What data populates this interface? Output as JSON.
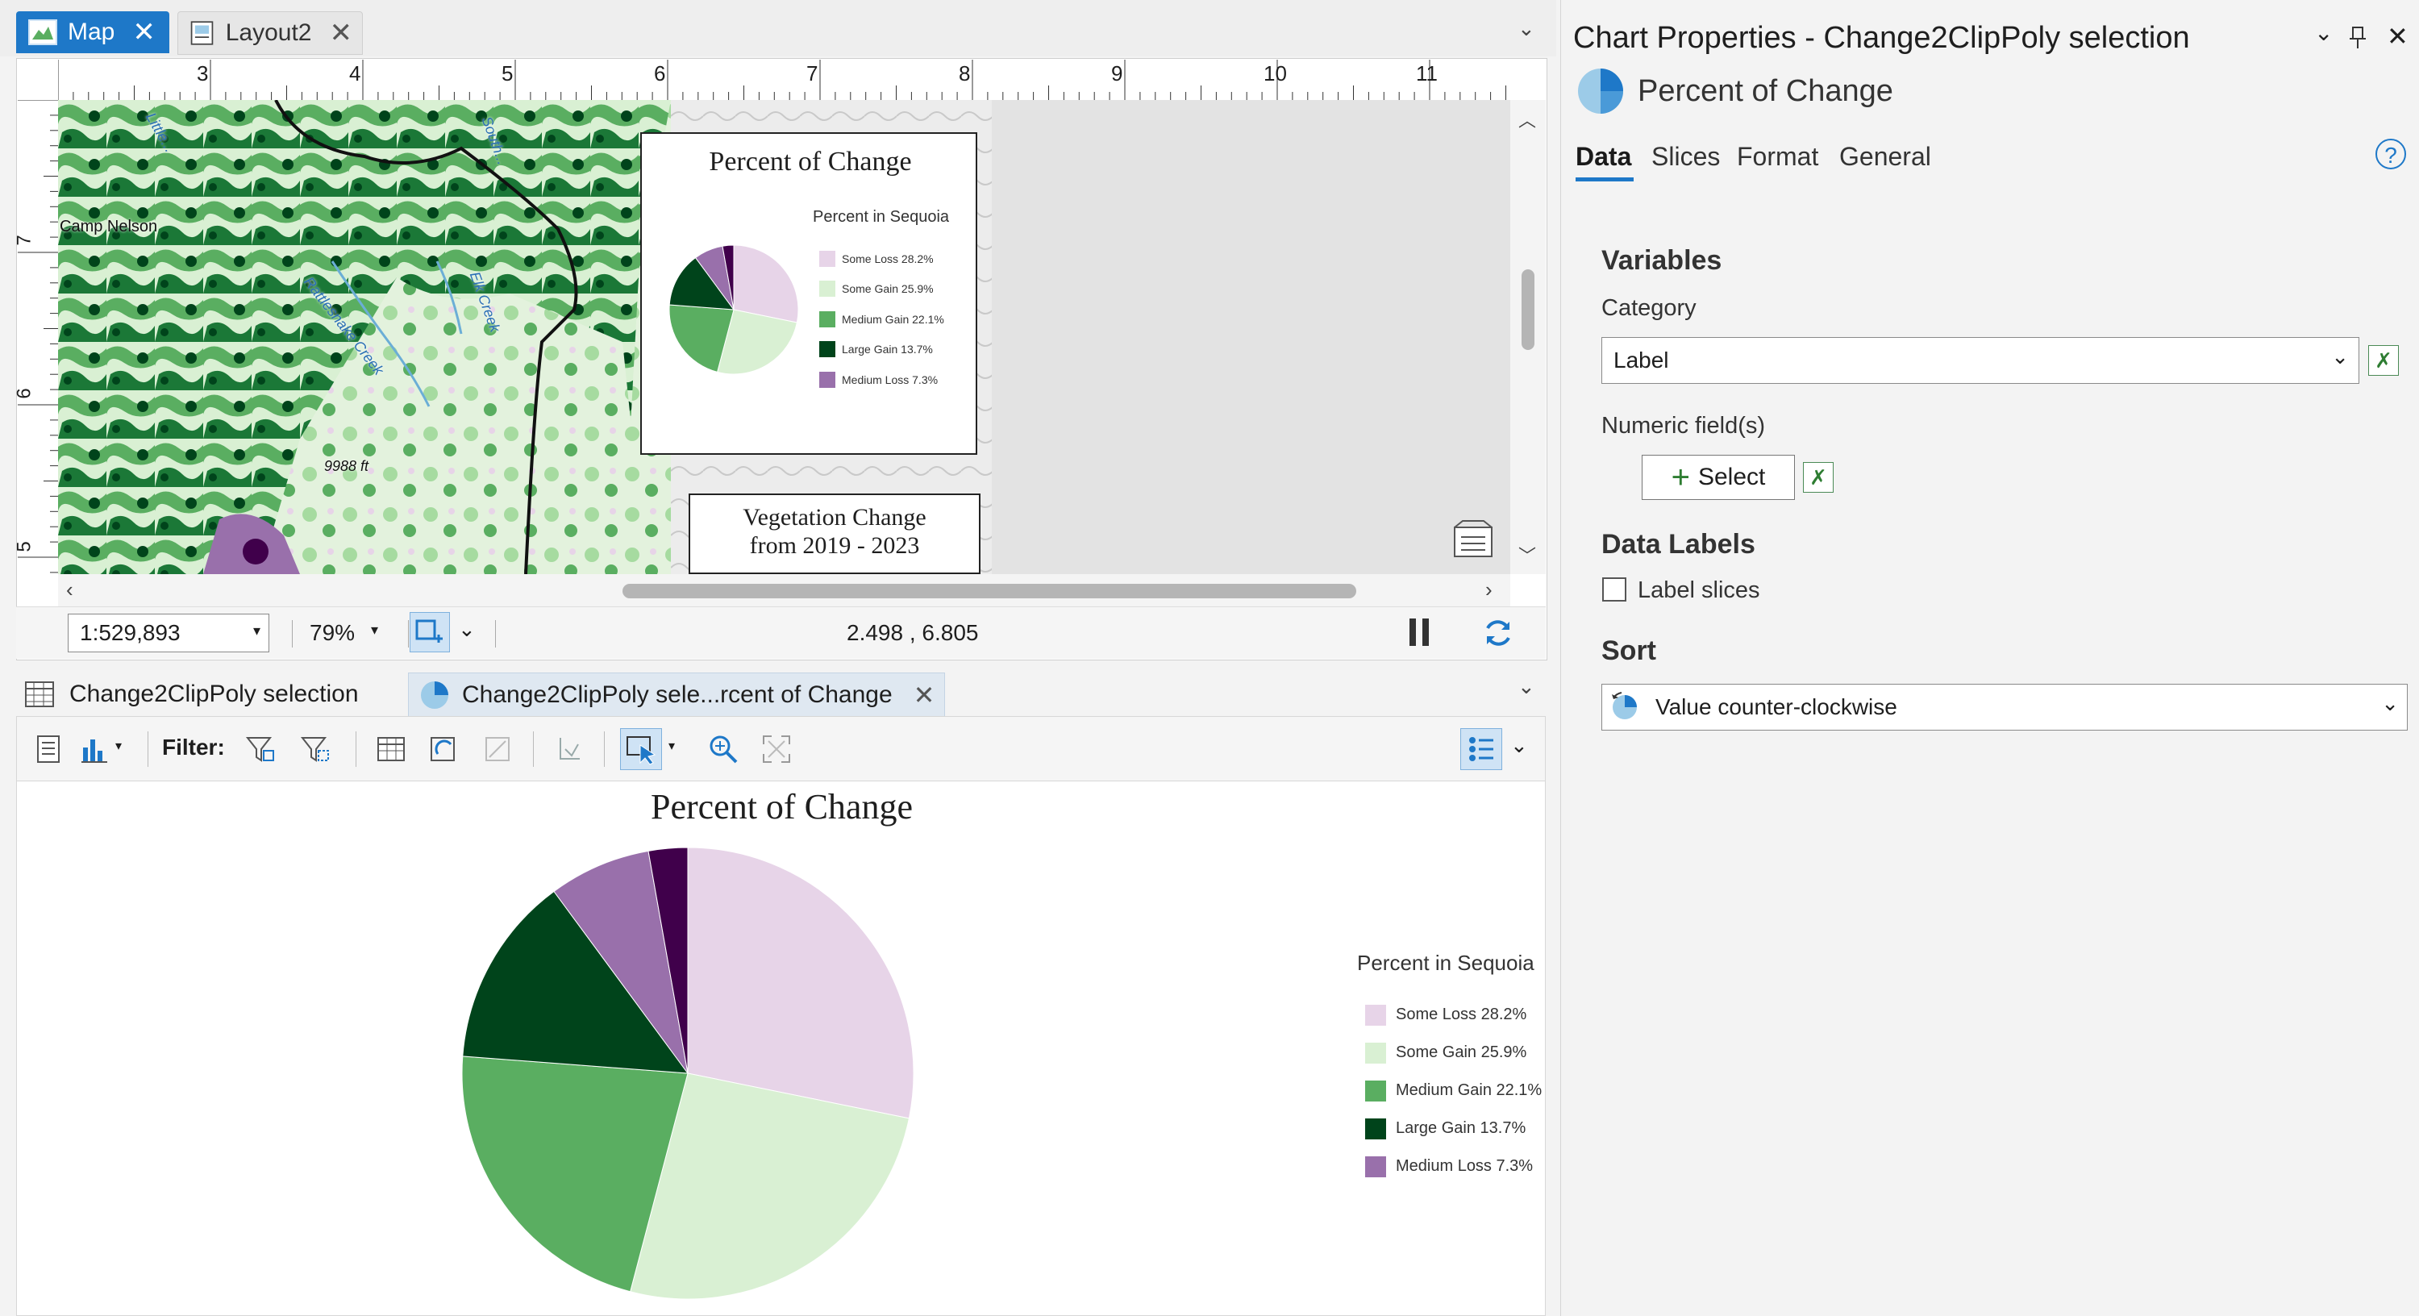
{
  "top_tabs": {
    "map": {
      "label": "Map"
    },
    "layout": {
      "label": "Layout2"
    }
  },
  "map": {
    "ruler_h": [
      "3",
      "4",
      "5",
      "6",
      "7",
      "8",
      "9",
      "10",
      "11"
    ],
    "ruler_v": [
      "7",
      "6",
      "5"
    ],
    "labels": {
      "camp_nelson": "Camp Nelson",
      "elevation": "9988 ft",
      "rattlesnake": "Rattlesnake Creek",
      "elk": "Elk Creek",
      "little": "Little...",
      "south": "South..."
    },
    "inset": {
      "title": "Percent of Change",
      "legend_title": "Percent in Sequoia"
    },
    "title_box": {
      "line1": "Vegetation Change",
      "line2": "from 2019 - 2023"
    },
    "scale": "1:529,893",
    "zoom": "79%",
    "coords": "2.498 , 6.805"
  },
  "bottom_tabs": {
    "table": {
      "label": "Change2ClipPoly selection"
    },
    "chart": {
      "label": "Change2ClipPoly sele...rcent of Change"
    }
  },
  "toolbar": {
    "filter_label": "Filter:"
  },
  "chart_data": {
    "type": "pie",
    "title": "Percent of Change",
    "legend_title": "Percent in Sequoia",
    "legend_position": "right",
    "slices": [
      {
        "label": "Some Loss 28.2%",
        "value": 28.2,
        "color": "#e7d4e8"
      },
      {
        "label": "Some Gain 25.9%",
        "value": 25.9,
        "color": "#d9f0d3"
      },
      {
        "label": "Medium Gain 22.1%",
        "value": 22.1,
        "color": "#5aae61"
      },
      {
        "label": "Large Gain 13.7%",
        "value": 13.7,
        "color": "#00441b"
      },
      {
        "label": "Medium Loss 7.3%",
        "value": 7.3,
        "color": "#9970ab"
      },
      {
        "label": "",
        "value": 2.8,
        "color": "#40004b"
      }
    ]
  },
  "properties": {
    "title": "Chart Properties - Change2ClipPoly selection",
    "chart_name": "Percent of Change",
    "tabs": [
      "Data",
      "Slices",
      "Format",
      "General"
    ],
    "active_tab": "Data",
    "variables_heading": "Variables",
    "category_label": "Category",
    "category_value": "Label",
    "numeric_label": "Numeric field(s)",
    "select_label": "Select",
    "data_labels_heading": "Data Labels",
    "label_slices": "Label slices",
    "label_slices_checked": false,
    "sort_heading": "Sort",
    "sort_value": "Value counter-clockwise",
    "help": "?"
  },
  "colors": {
    "accent": "#1e78c8",
    "tab_active": "#1e78c8"
  }
}
